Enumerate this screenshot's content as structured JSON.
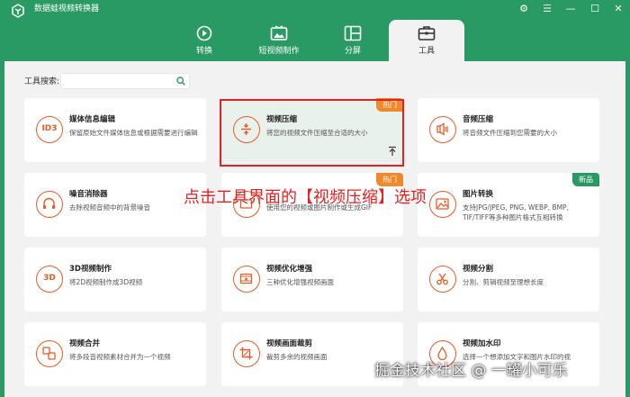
{
  "app": {
    "title": "数据蛙视频转换器"
  },
  "window_controls": {
    "settings": "⚙",
    "menu": "☰",
    "minimize": "—",
    "maximize": "☐",
    "close": "✕"
  },
  "tabs": [
    {
      "label": "转换",
      "icon": "convert-icon",
      "active": false
    },
    {
      "label": "短视频制作",
      "icon": "short-video-icon",
      "active": false
    },
    {
      "label": "分屏",
      "icon": "split-screen-icon",
      "active": false
    },
    {
      "label": "工具",
      "icon": "toolbox-icon",
      "active": true
    }
  ],
  "search": {
    "label": "工具搜索:",
    "placeholder": ""
  },
  "tools": [
    {
      "title": "媒体信息编辑",
      "desc": "保留原始文件媒体信息或根据需要进行编辑",
      "icon": "id3-icon",
      "icon_text": "ID3"
    },
    {
      "title": "视频压缩",
      "desc": "将您的视频文件压缩至合适的大小",
      "icon": "compress-icon",
      "badge": "热门"
    },
    {
      "title": "音频压缩",
      "desc": "将音频文件压缩到您需要的大小",
      "icon": "audio-compress-icon"
    },
    {
      "title": "噪音消除器",
      "desc": "去除视频音频中的背景噪音",
      "icon": "noise-icon"
    },
    {
      "title": "",
      "desc": "使用您的视频或图片制作或生成GIF",
      "icon": "gif-icon",
      "badge": "热门"
    },
    {
      "title": "图片转换",
      "desc": "支持JPG/JPEG, PNG, WEBP, BMP, TIF/TIFF等多种图片格式互相转换",
      "icon": "image-convert-icon",
      "badge": "新品"
    },
    {
      "title": "3D视频制作",
      "desc": "将2D视频制作成3D视频",
      "icon": "3d-icon",
      "icon_text": "3D"
    },
    {
      "title": "视频优化增强",
      "desc": "三种优化增强视频画面",
      "icon": "enhance-icon"
    },
    {
      "title": "视频分割",
      "desc": "分割、剪辑视频至理想长度",
      "icon": "scissors-icon"
    },
    {
      "title": "视频合并",
      "desc": "将多段音视频素材合并为一个视频",
      "icon": "merge-icon"
    },
    {
      "title": "视频画面裁剪",
      "desc": "裁剪多余的视频画面",
      "icon": "crop-icon"
    },
    {
      "title": "视频加水印",
      "desc": "选择一个想添加文字和图片水印的视",
      "icon": "watermark-icon"
    }
  ],
  "overlay_caption": "点击工具界面的【视频压缩】选项",
  "watermark": "掘金技术社区 @ 一罐小可乐",
  "colors": {
    "brand": "#2a9a64",
    "accent": "#ea5b25",
    "hot_badge": "#f0892c",
    "annotation": "#e52222"
  }
}
